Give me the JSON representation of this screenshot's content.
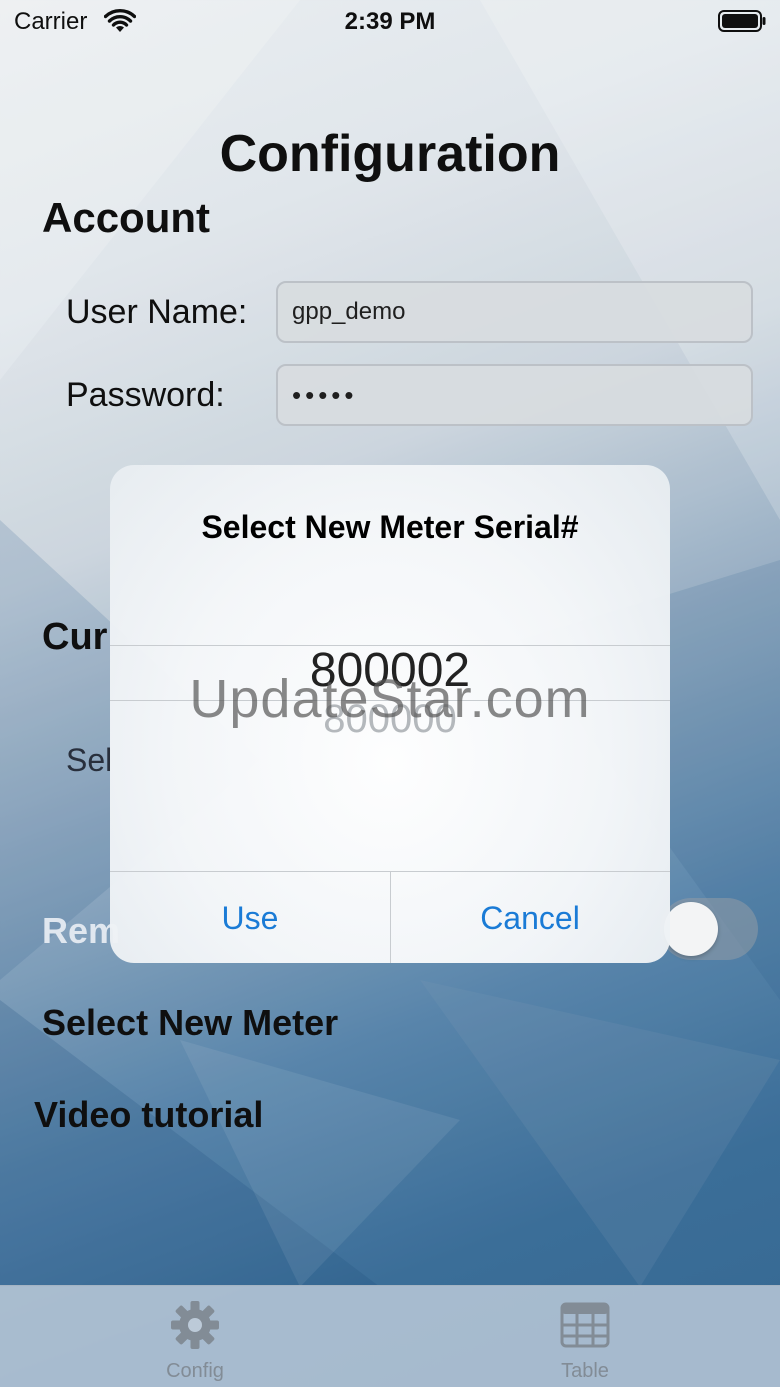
{
  "status_bar": {
    "carrier": "Carrier",
    "time": "2:39 PM"
  },
  "page": {
    "title": "Configuration"
  },
  "account": {
    "heading": "Account",
    "username_label": "User Name:",
    "username_value": "gpp_demo",
    "password_label": "Password:",
    "password_value": "•••••"
  },
  "background_labels": {
    "current_partial": "Cur",
    "select_partial": "Sel",
    "remember_partial": "Rem",
    "select_new_meter": "Select New Meter",
    "video_tutorial": "Video tutorial"
  },
  "alert": {
    "title": "Select New Meter Serial#",
    "picker_selected": "800002",
    "picker_next": "800000",
    "use_label": "Use",
    "cancel_label": "Cancel"
  },
  "tab_bar": {
    "tabs": [
      {
        "label": "Config",
        "icon": "gear-icon"
      },
      {
        "label": "Table",
        "icon": "table-icon"
      }
    ]
  },
  "watermark": "UpdateStar.com",
  "colors": {
    "accent": "#1a7bd6",
    "tab_inactive": "#7b8590"
  }
}
